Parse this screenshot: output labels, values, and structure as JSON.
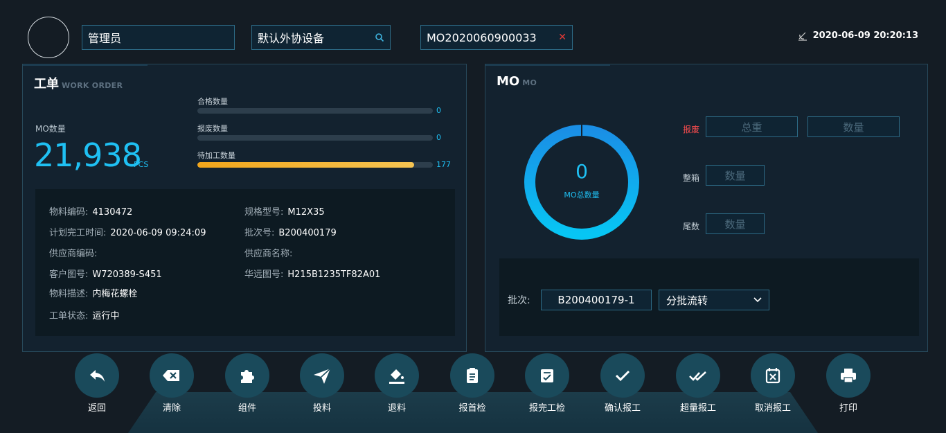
{
  "header": {
    "user_name": "管理员",
    "device": "默认外协设备",
    "mo_number": "MO2020060900033",
    "datetime": "2020-06-09 20:20:13"
  },
  "work_order": {
    "title": "工单",
    "subtitle": "WORK ORDER",
    "mo_qty_label": "MO数量",
    "mo_qty_value": "21,938",
    "mo_qty_unit": "PCS",
    "bars": [
      {
        "label": "合格数量",
        "value": "0",
        "fill": 0
      },
      {
        "label": "报废数量",
        "value": "0",
        "fill": 0
      },
      {
        "label": "待加工数量",
        "value": "177",
        "fill": 0.92
      }
    ],
    "details": {
      "material_code_label": "物料编码:",
      "material_code": "4130472",
      "spec_label": "规格型号:",
      "spec": "M12X35",
      "plan_time_label": "计划完工时间:",
      "plan_time": "2020-06-09 09:24:09",
      "batch_label": "批次号:",
      "batch": "B200400179",
      "supplier_code_label": "供应商编码:",
      "supplier_code": "",
      "supplier_name_label": "供应商名称:",
      "supplier_name": "",
      "customer_drawing_label": "客户图号:",
      "customer_drawing": "W720389-S451",
      "hy_drawing_label": "华远图号:",
      "hy_drawing": "H215B1235TF82A01",
      "material_desc_label": "物料描述:",
      "material_desc": "内梅花螺栓",
      "status_label": "工单状态:",
      "status": "运行中"
    }
  },
  "mo": {
    "title": "MO",
    "subtitle": "MO",
    "total_value": "0",
    "total_label": "MO总数量",
    "scrap_label": "报废",
    "scrap_weight_placeholder": "总重",
    "scrap_qty_placeholder": "数量",
    "full_box_label": "整箱",
    "full_box_placeholder": "数量",
    "tail_label": "尾数",
    "tail_placeholder": "数量",
    "batch_label": "批次:",
    "batch_value": "B200400179-1",
    "split_option": "分批流转"
  },
  "toolbar": [
    {
      "label": "返回",
      "icon": "reply-icon"
    },
    {
      "label": "清除",
      "icon": "backspace-icon"
    },
    {
      "label": "组件",
      "icon": "puzzle-icon"
    },
    {
      "label": "投料",
      "icon": "send-icon"
    },
    {
      "label": "退料",
      "icon": "paint-bucket-icon"
    },
    {
      "label": "报首检",
      "icon": "clipboard-icon"
    },
    {
      "label": "报完工检",
      "icon": "check-list-icon"
    },
    {
      "label": "确认报工",
      "icon": "check-icon"
    },
    {
      "label": "超量报工",
      "icon": "double-check-icon"
    },
    {
      "label": "取消报工",
      "icon": "calendar-x-icon"
    },
    {
      "label": "打印",
      "icon": "printer-icon"
    }
  ],
  "colors": {
    "accent": "#1fc0f3",
    "progress": "#f2a61b",
    "danger": "#ff4d4f"
  }
}
